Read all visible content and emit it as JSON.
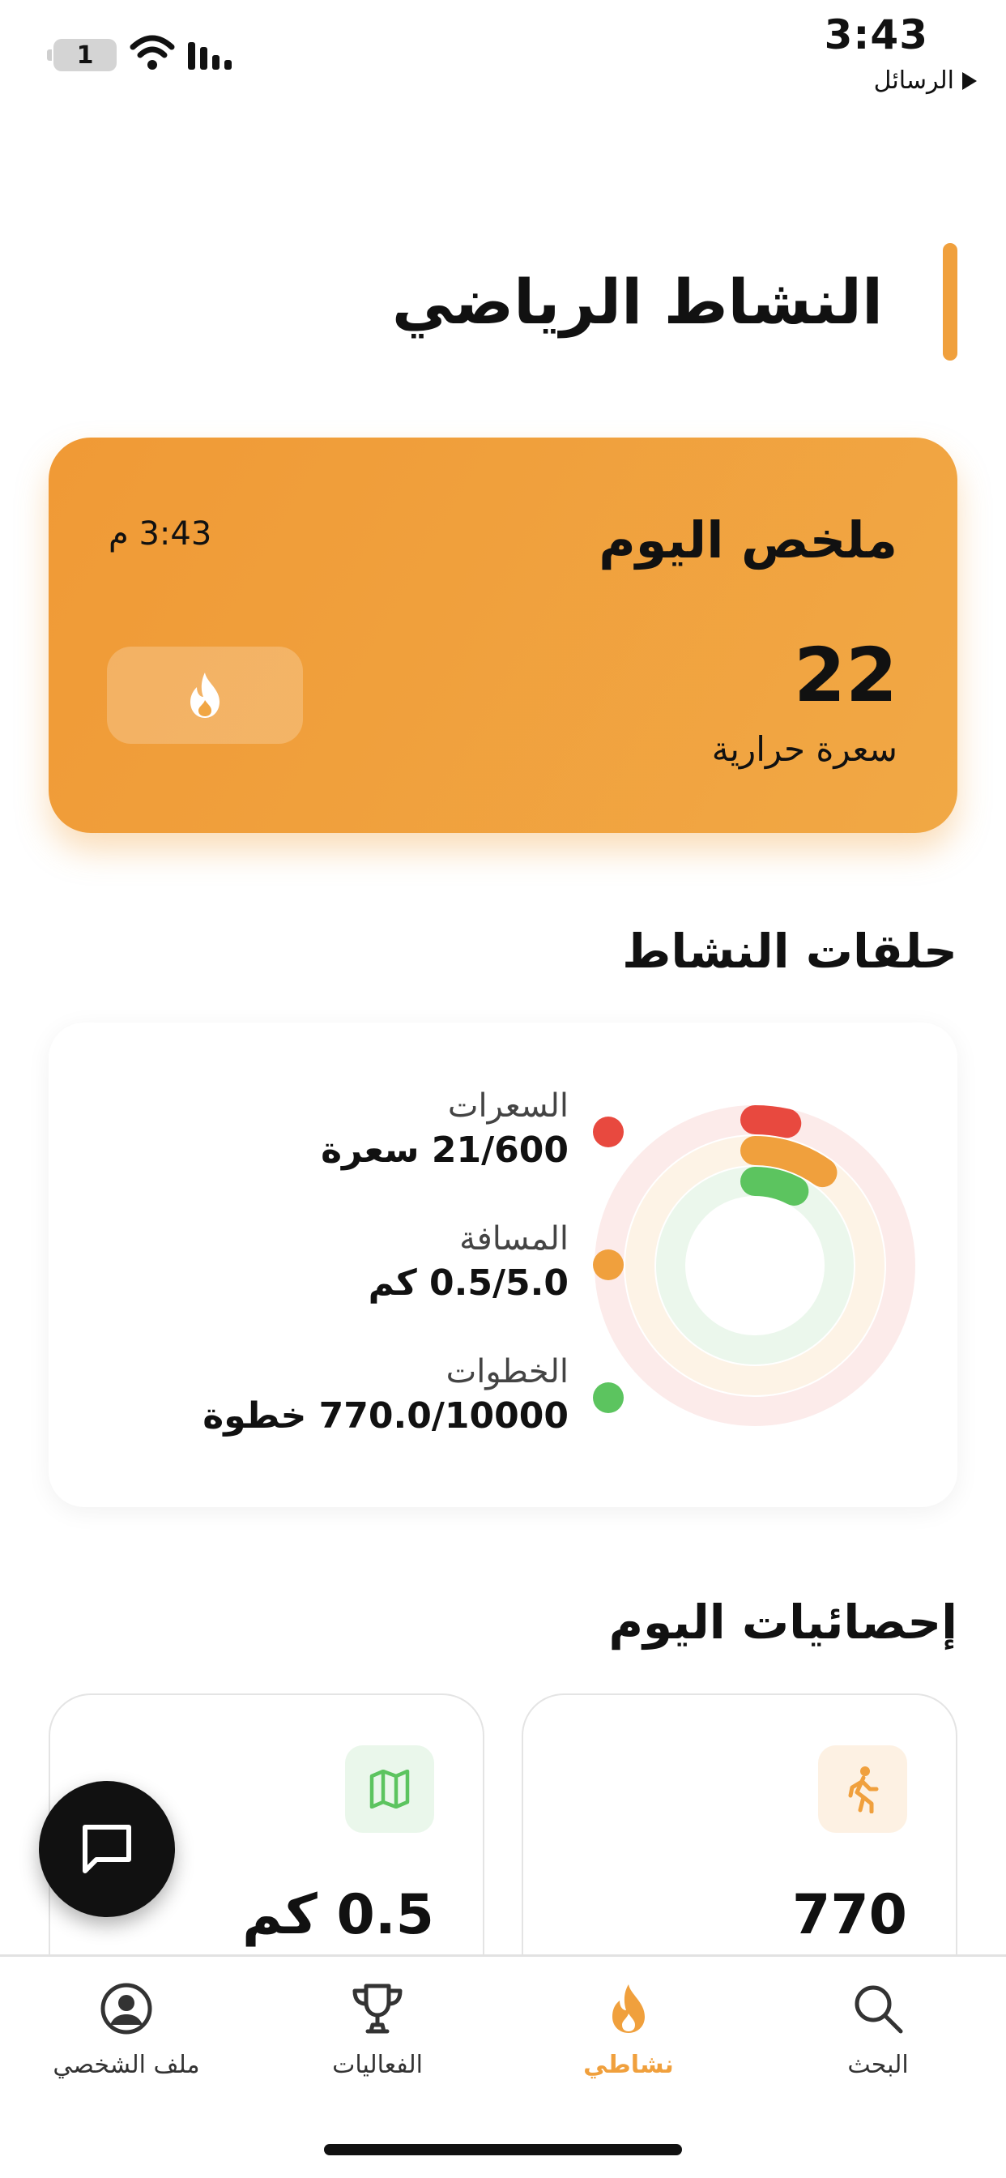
{
  "status_bar": {
    "battery_level": "1",
    "time": "3:43",
    "back_label": "الرسائل"
  },
  "page": {
    "title": "النشاط الرياضي"
  },
  "summary": {
    "title": "ملخص اليوم",
    "time": "3:43 م",
    "value": "22",
    "unit": "سعرة حرارية"
  },
  "rings_section": {
    "title": "حلقات النشاط",
    "items": [
      {
        "label": "السعرات",
        "value": "21/600 سعرة",
        "color": "#e8493f",
        "progress": 0.035
      },
      {
        "label": "المسافة",
        "value": "0.5/5.0 كم",
        "color": "#f0a03d",
        "progress": 0.1
      },
      {
        "label": "الخطوات",
        "value": "770.0/10000 خطوة",
        "color": "#5cc45f",
        "progress": 0.077
      }
    ]
  },
  "stats_section": {
    "title": "إحصائيات اليوم",
    "cards": [
      {
        "value": "770",
        "icon": "walking-icon",
        "color": "#f0a03d"
      },
      {
        "value": "0.5 كم",
        "icon": "map-icon",
        "color": "#5cc45f"
      }
    ]
  },
  "tabs": [
    {
      "label": "البحث",
      "icon": "search-icon",
      "active": false
    },
    {
      "label": "نشاطي",
      "icon": "flame-icon",
      "active": true
    },
    {
      "label": "الفعاليات",
      "icon": "trophy-icon",
      "active": false
    },
    {
      "label": "ملف الشخصي",
      "icon": "profile-icon",
      "active": false
    }
  ],
  "colors": {
    "accent": "#f0a03d",
    "red": "#e8493f",
    "green": "#5cc45f"
  }
}
